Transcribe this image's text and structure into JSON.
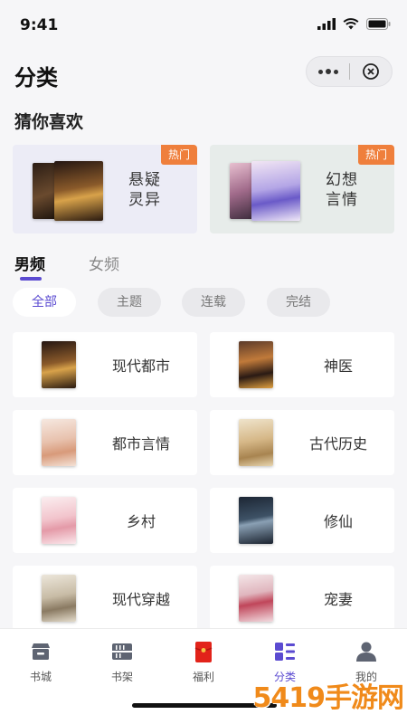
{
  "status": {
    "time": "9:41"
  },
  "header": {
    "title": "分类"
  },
  "guess": {
    "title": "猜你喜欢",
    "cards": [
      {
        "badge": "热门",
        "line1": "悬疑",
        "line2": "灵异"
      },
      {
        "badge": "热门",
        "line1": "幻想",
        "line2": "言情"
      }
    ]
  },
  "gender_tabs": [
    "男频",
    "女频"
  ],
  "filters": [
    "全部",
    "主题",
    "连载",
    "完结"
  ],
  "categories": [
    {
      "label": "现代都市",
      "cover_color": "#3a2a1e"
    },
    {
      "label": "神医",
      "cover_color": "#4a2a22"
    },
    {
      "label": "都市言情",
      "cover_color": "#f0d6c6"
    },
    {
      "label": "古代历史",
      "cover_color": "#d9c39a"
    },
    {
      "label": "乡村",
      "cover_color": "#f4d4d8"
    },
    {
      "label": "修仙",
      "cover_color": "#2c3a4a"
    },
    {
      "label": "现代穿越",
      "cover_color": "#d8d0c0"
    },
    {
      "label": "宠妻",
      "cover_color": "#e8d0d4"
    }
  ],
  "tabbar": [
    {
      "label": "书城",
      "icon": "store-icon"
    },
    {
      "label": "书架",
      "icon": "bookshelf-icon"
    },
    {
      "label": "福利",
      "icon": "red-envelope-icon"
    },
    {
      "label": "分类",
      "icon": "category-grid-icon"
    },
    {
      "label": "我的",
      "icon": "user-icon"
    }
  ],
  "watermark": "5419手游网",
  "colors": {
    "accent": "#5b4bd1",
    "badge": "#ef7f3c",
    "background": "#f6f6f8"
  }
}
